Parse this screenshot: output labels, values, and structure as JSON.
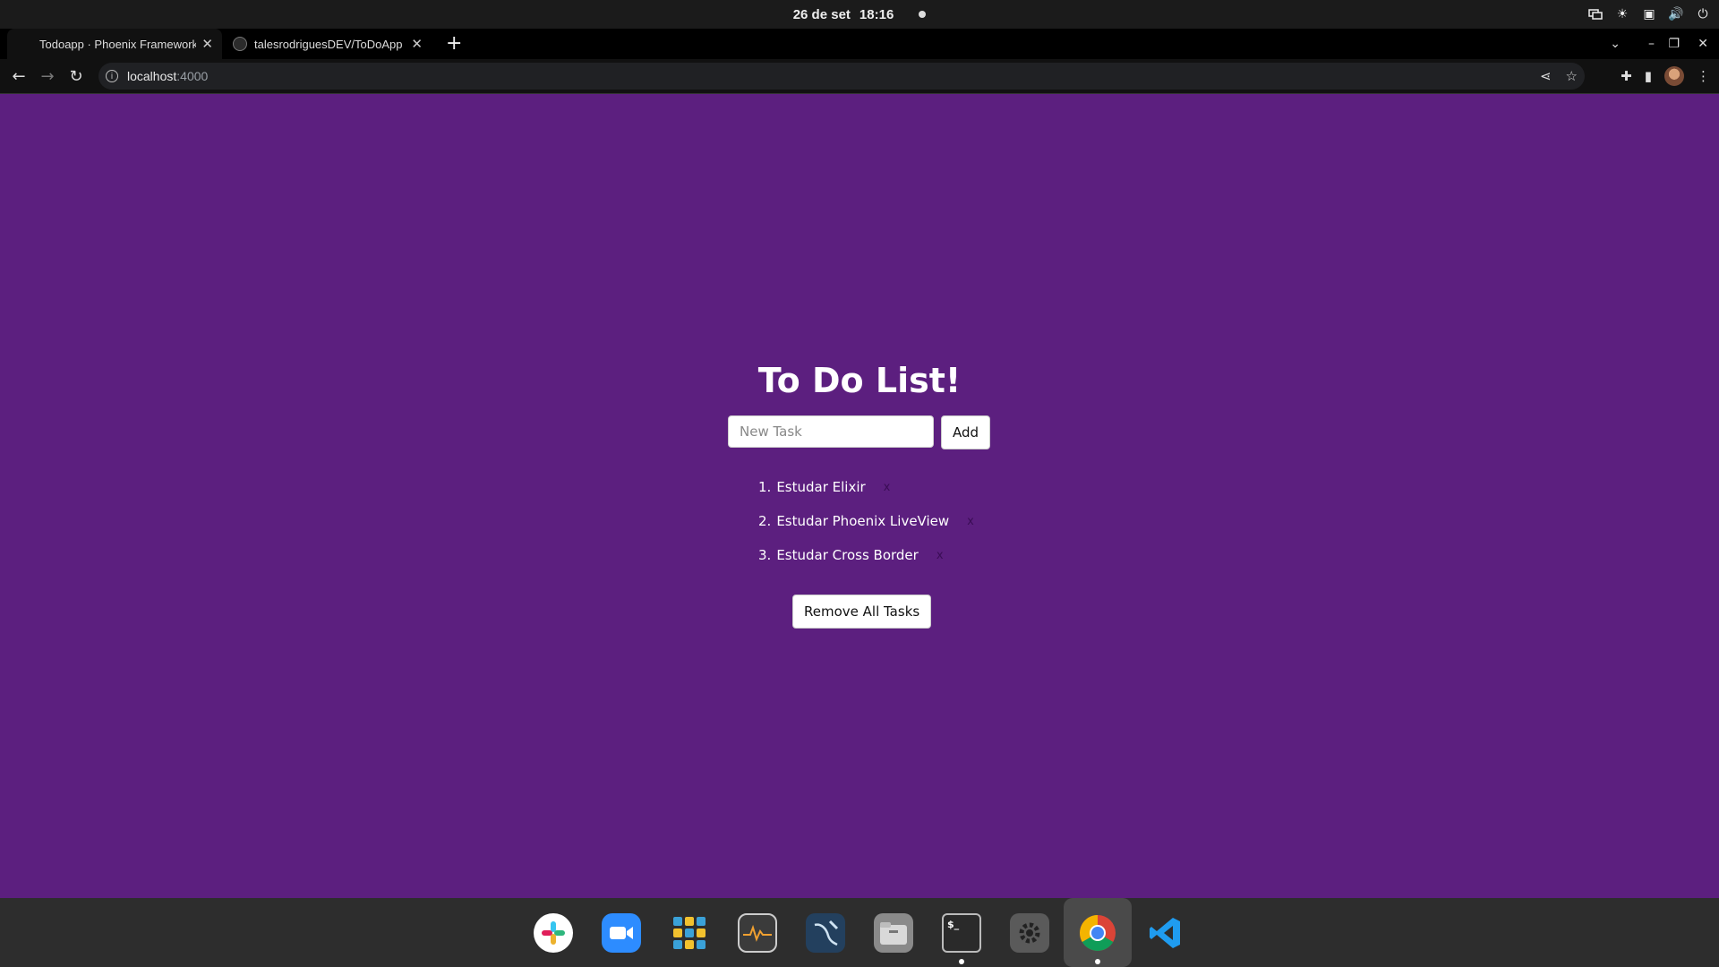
{
  "system": {
    "date": "26 de set",
    "time": "18:16"
  },
  "browser": {
    "tabs": [
      {
        "title": "Todoapp · Phoenix Framework"
      },
      {
        "title": "talesrodriguesDEV/ToDoApp"
      }
    ],
    "url": {
      "host": "localhost",
      "port": ":4000"
    }
  },
  "todo": {
    "heading": "To Do List!",
    "input_placeholder": "New Task",
    "input_value": "",
    "add_label": "Add",
    "items": [
      {
        "num": "1.",
        "text": "Estudar Elixir",
        "delete": "x"
      },
      {
        "num": "2.",
        "text": "Estudar Phoenix LiveView",
        "delete": "x"
      },
      {
        "num": "3.",
        "text": "Estudar Cross Border",
        "delete": "x"
      }
    ],
    "remove_all_label": "Remove All Tasks"
  },
  "colors": {
    "page_background": "#5c1f7f",
    "accent_text": "#ffffff"
  },
  "dock": {
    "apps": [
      {
        "icon": "slack-icon"
      },
      {
        "icon": "zoom-icon"
      },
      {
        "icon": "app-grid-icon"
      },
      {
        "icon": "system-monitor-icon"
      },
      {
        "icon": "mysql-workbench-icon"
      },
      {
        "icon": "files-icon"
      },
      {
        "icon": "terminal-icon"
      },
      {
        "icon": "settings-icon"
      },
      {
        "icon": "chrome-icon"
      },
      {
        "icon": "vscode-icon"
      }
    ]
  }
}
